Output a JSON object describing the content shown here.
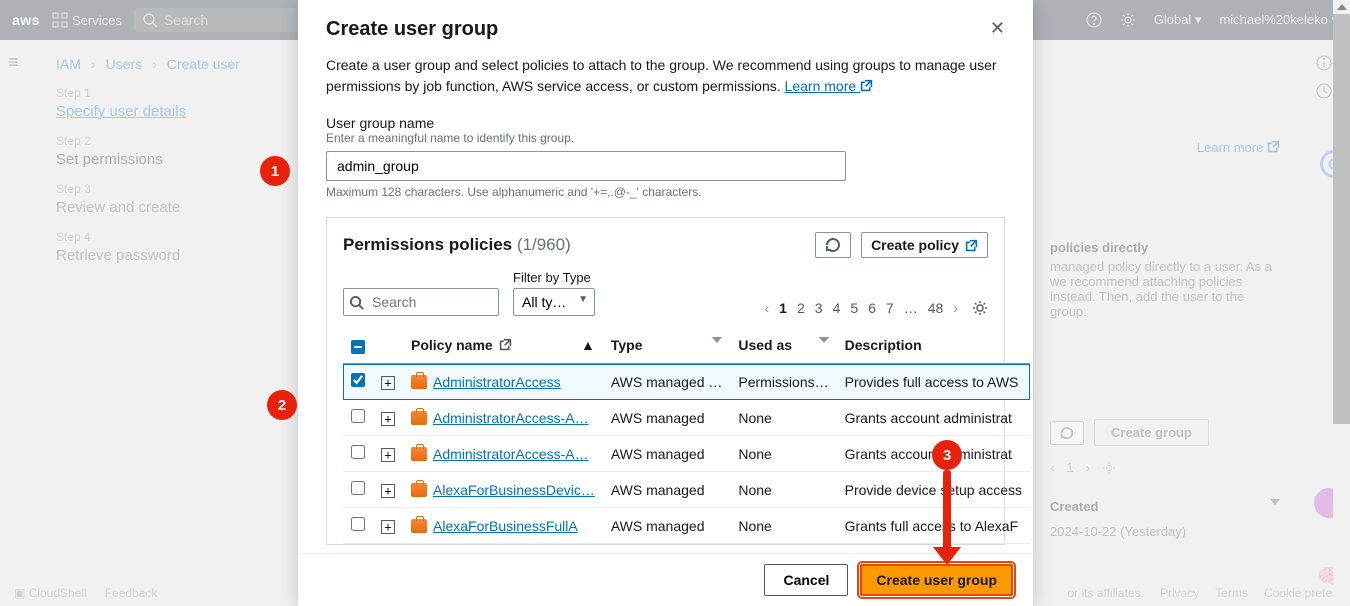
{
  "navbar": {
    "logo": "aws",
    "services": "Services",
    "search_placeholder": "Search",
    "global": "Global",
    "user": "michael%20keleko"
  },
  "breadcrumb": {
    "a": "IAM",
    "b": "Users",
    "c": "Create user"
  },
  "steps": {
    "s1": {
      "label": "Step 1",
      "name": "Specify user details"
    },
    "s2": {
      "label": "Step 2",
      "name": "Set permissions"
    },
    "s3": {
      "label": "Step 3",
      "name": "Review and create"
    },
    "s4": {
      "label": "Step 4",
      "name": "Retrieve password"
    }
  },
  "modal": {
    "title": "Create user group",
    "intro": "Create a user group and select policies to attach to the group. We recommend using groups to manage user permissions by job function, AWS service access, or custom permissions. ",
    "learn_more": "Learn more",
    "group_label": "User group name",
    "group_sub": "Enter a meaningful name to identify this group.",
    "group_value": "admin_group",
    "group_hint": "Maximum 128 characters. Use alphanumeric and '+=,.@-_' characters.",
    "policies_hdr": "Permissions policies",
    "policies_count": "(1/960)",
    "refresh": "Refresh",
    "create_policy": "Create policy",
    "filter_label": "Filter by Type",
    "type_sel": "All ty…",
    "search_placeholder": "Search",
    "pages": [
      "1",
      "2",
      "3",
      "4",
      "5",
      "6",
      "7",
      "…",
      "48"
    ],
    "th": {
      "policy": "Policy name",
      "type": "Type",
      "used": "Used as",
      "desc": "Description"
    },
    "rows": [
      {
        "name": "AdministratorAccess",
        "type": "AWS managed …",
        "used": "Permissions…",
        "desc": "Provides full access to AWS",
        "checked": true
      },
      {
        "name": "AdministratorAccess-A…",
        "type": "AWS managed",
        "used": "None",
        "desc": "Grants account administrat",
        "checked": false
      },
      {
        "name": "AdministratorAccess-A…",
        "type": "AWS managed",
        "used": "None",
        "desc": "Grants account administrat",
        "checked": false
      },
      {
        "name": "AlexaForBusinessDevic…",
        "type": "AWS managed",
        "used": "None",
        "desc": "Provide device setup access",
        "checked": false
      },
      {
        "name": "AlexaForBusinessFullA",
        "type": "AWS managed",
        "used": "None",
        "desc": "Grants full access to AlexaF",
        "checked": false
      }
    ],
    "cancel": "Cancel",
    "create": "Create user group"
  },
  "background": {
    "policies_directly_h": "policies directly",
    "policies_directly_body": "managed policy directly to a user. As a we recommend attaching policies instead. Then, add the user to the group.",
    "learn_more_bg": "Learn more",
    "create_group_btn": "Create group",
    "created_col": "Created",
    "created_val": "2024-10-22 (Yesterday)",
    "page1": "1",
    "cloudshell": "CloudShell",
    "feedback": "Feedback",
    "copyright": "or its affiliates.",
    "privacy": "Privacy",
    "terms": "Terms",
    "cookie": "Cookie prefer"
  },
  "annotations": {
    "a1": "1",
    "a2": "2",
    "a3": "3"
  }
}
